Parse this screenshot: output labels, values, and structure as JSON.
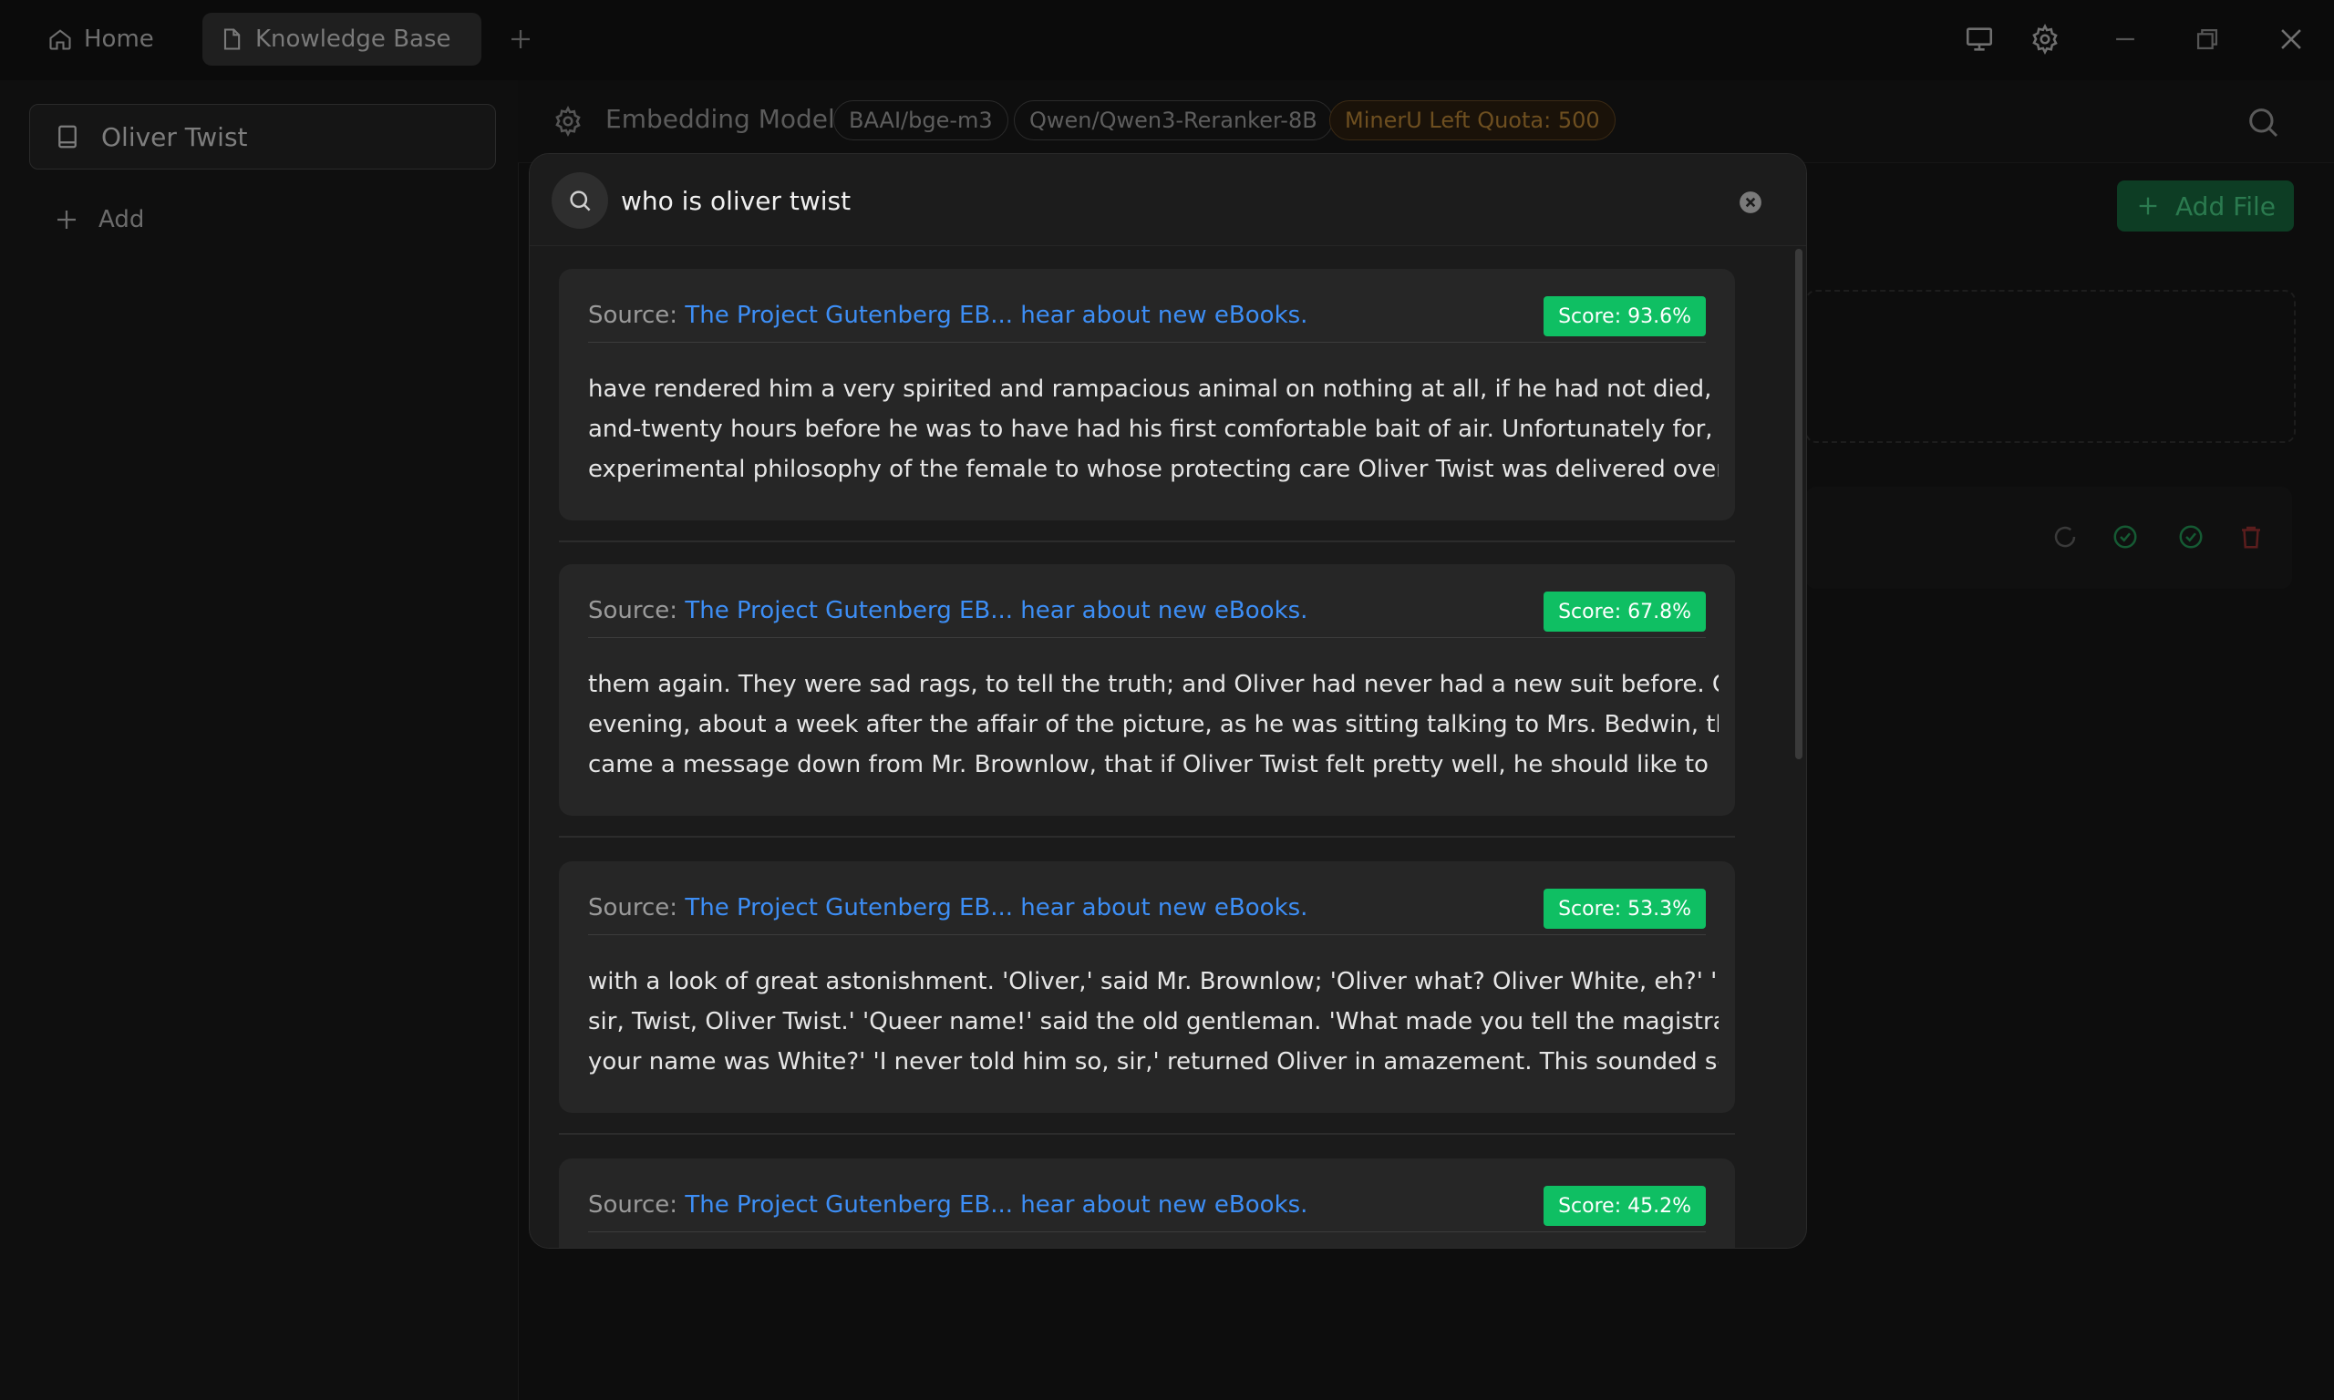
{
  "titlebar": {
    "tabs": [
      {
        "label": "Home",
        "icon": "home-icon"
      },
      {
        "label": "Knowledge Base",
        "icon": "file-icon"
      }
    ],
    "new_tab_icon": "plus-icon",
    "controls": [
      "monitor-icon",
      "gear-icon",
      "minimize-icon",
      "restore-icon",
      "close-icon"
    ]
  },
  "sidebar": {
    "knowledge_bases": [
      {
        "label": "Oliver Twist",
        "icon": "book-icon"
      }
    ],
    "add_label": "Add"
  },
  "header": {
    "embedding_label": "Embedding Model",
    "chips": [
      "BAAI/bge-m3",
      "Qwen/Qwen3-Reranker-8B",
      "MinerU Left Quota: 500"
    ],
    "add_file_label": "Add File"
  },
  "search": {
    "query": "who is oliver twist",
    "results": [
      {
        "source_label": "Source:",
        "source_link": "The Project Gutenberg EB... hear about new eBooks.",
        "score": "Score: 93.6%",
        "lines": [
          "have rendered him a very spirited and rampacious animal on nothing at all, if he had not died, four-",
          "and-twenty hours before he was to have had his first comfortable bait of air. Unfortunately for, the",
          "experimental philosophy of the female to whose protecting care Oliver Twist was delivered over, a"
        ]
      },
      {
        "source_label": "Source:",
        "source_link": "The Project Gutenberg EB... hear about new eBooks.",
        "score": "Score: 67.8%",
        "lines": [
          "them again. They were sad rags, to tell the truth; and Oliver had never had a new suit before. One",
          "evening, about a week after the affair of the picture, as he was sitting talking to Mrs. Bedwin, there",
          "came a message down from Mr. Brownlow, that if Oliver Twist felt pretty well, he should like to"
        ]
      },
      {
        "source_label": "Source:",
        "source_link": "The Project Gutenberg EB... hear about new eBooks.",
        "score": "Score: 53.3%",
        "lines": [
          "with a look of great astonishment. 'Oliver,' said Mr. Brownlow; 'Oliver what? Oliver White, eh?' 'No,",
          "sir, Twist, Oliver Twist.' 'Queer name!' said the old gentleman. 'What made you tell the magistrate",
          "your name was White?' 'I never told him so, sir,' returned Oliver in amazement. This sounded so"
        ]
      },
      {
        "source_label": "Source:",
        "source_link": "The Project Gutenberg EB... hear about new eBooks.",
        "score": "Score: 45.2%",
        "lines": []
      }
    ]
  },
  "colors": {
    "accent": "#0fbf63",
    "link": "#3d8ef5",
    "modal_bg": "#1b1b1b",
    "card_bg": "#262626"
  }
}
